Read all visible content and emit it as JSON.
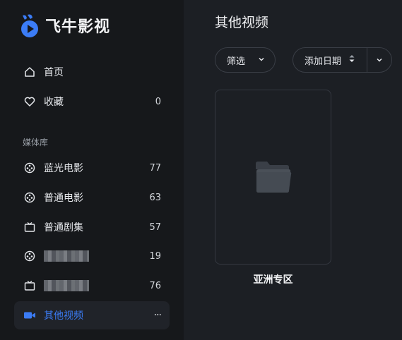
{
  "app": {
    "name": "飞牛影视",
    "accent": "#3b7cf6"
  },
  "sidebar": {
    "home": {
      "label": "首页",
      "icon": "home-icon"
    },
    "favorites": {
      "label": "收藏",
      "count": "0",
      "icon": "heart-icon"
    },
    "library_title": "媒体库",
    "libraries": [
      {
        "label": "蓝光电影",
        "count": "77",
        "icon": "film-reel-icon"
      },
      {
        "label": "普通电影",
        "count": "63",
        "icon": "film-reel-icon"
      },
      {
        "label": "普通剧集",
        "count": "57",
        "icon": "tv-icon"
      },
      {
        "label": "",
        "count": "19",
        "icon": "film-reel-icon",
        "redacted": true
      },
      {
        "label": "",
        "count": "76",
        "icon": "tv-icon",
        "redacted": true
      },
      {
        "label": "其他视频",
        "icon": "video-camera-icon",
        "active": true,
        "more": "···"
      }
    ]
  },
  "main": {
    "title": "其他视频",
    "filter_label": "筛选",
    "sort_label": "添加日期",
    "folders": [
      {
        "label": "亚洲专区",
        "icon": "folder-icon"
      }
    ]
  }
}
